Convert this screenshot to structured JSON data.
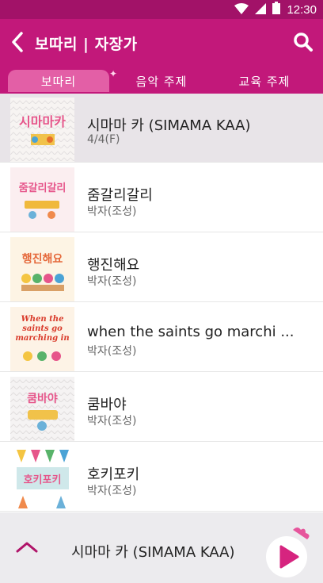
{
  "status_bar": {
    "time": "12:30"
  },
  "app_bar": {
    "title": "보따리 | 자장가"
  },
  "tabs": [
    {
      "label": "보따리",
      "active": true
    },
    {
      "label": "음악 주제",
      "active": false
    },
    {
      "label": "교육 주제",
      "active": false
    }
  ],
  "songs": [
    {
      "title": "시마마 카 (SIMAMA KAA)",
      "subtitle": "4/4(F)",
      "selected": true,
      "thumb_text": "시마마카"
    },
    {
      "title": "줌갈리갈리",
      "subtitle": "박자(조성)",
      "selected": false,
      "thumb_text": "줌갈리갈리"
    },
    {
      "title": "행진해요",
      "subtitle": "박자(조성)",
      "selected": false,
      "thumb_text": "행진해요"
    },
    {
      "title": "when the saints go marchi ...",
      "subtitle": "박자(조성)",
      "selected": false,
      "thumb_text": "When the saints go marching in"
    },
    {
      "title": "쿰바야",
      "subtitle": "박자(조성)",
      "selected": false,
      "thumb_text": "쿰바야"
    },
    {
      "title": "호키포키",
      "subtitle": "박자(조성)",
      "selected": false,
      "thumb_text": "호키포키"
    }
  ],
  "player": {
    "now_playing": "시마마 카 (SIMAMA KAA)"
  },
  "colors": {
    "primary": "#c2187a",
    "status": "#a21268",
    "tab_active": "#e35fa6",
    "accent_play": "#d6247f"
  }
}
